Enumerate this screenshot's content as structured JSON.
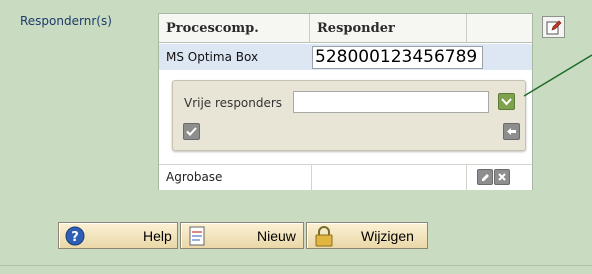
{
  "field": {
    "label": "Respondernr(s)"
  },
  "grid": {
    "columns": [
      "Procescomp.",
      "Responder"
    ],
    "rows": [
      {
        "procescomp": "MS Optima Box",
        "responder": "528000123456789",
        "selected": true
      },
      {
        "procescomp": "Agrobase",
        "responder": ""
      }
    ]
  },
  "panel": {
    "label": "Vrije responders",
    "value": ""
  },
  "buttons": {
    "help": "Help",
    "nieuw": "Nieuw",
    "wijzigen": "Wijzigen"
  },
  "colors": {
    "background": "#c9dcc2",
    "label_text": "#1d3a6b",
    "selected_row": "#dde7f4",
    "panel": "#e9e5d6",
    "green_button": "#7fa24f",
    "leader_line": "#1f6b2a"
  }
}
